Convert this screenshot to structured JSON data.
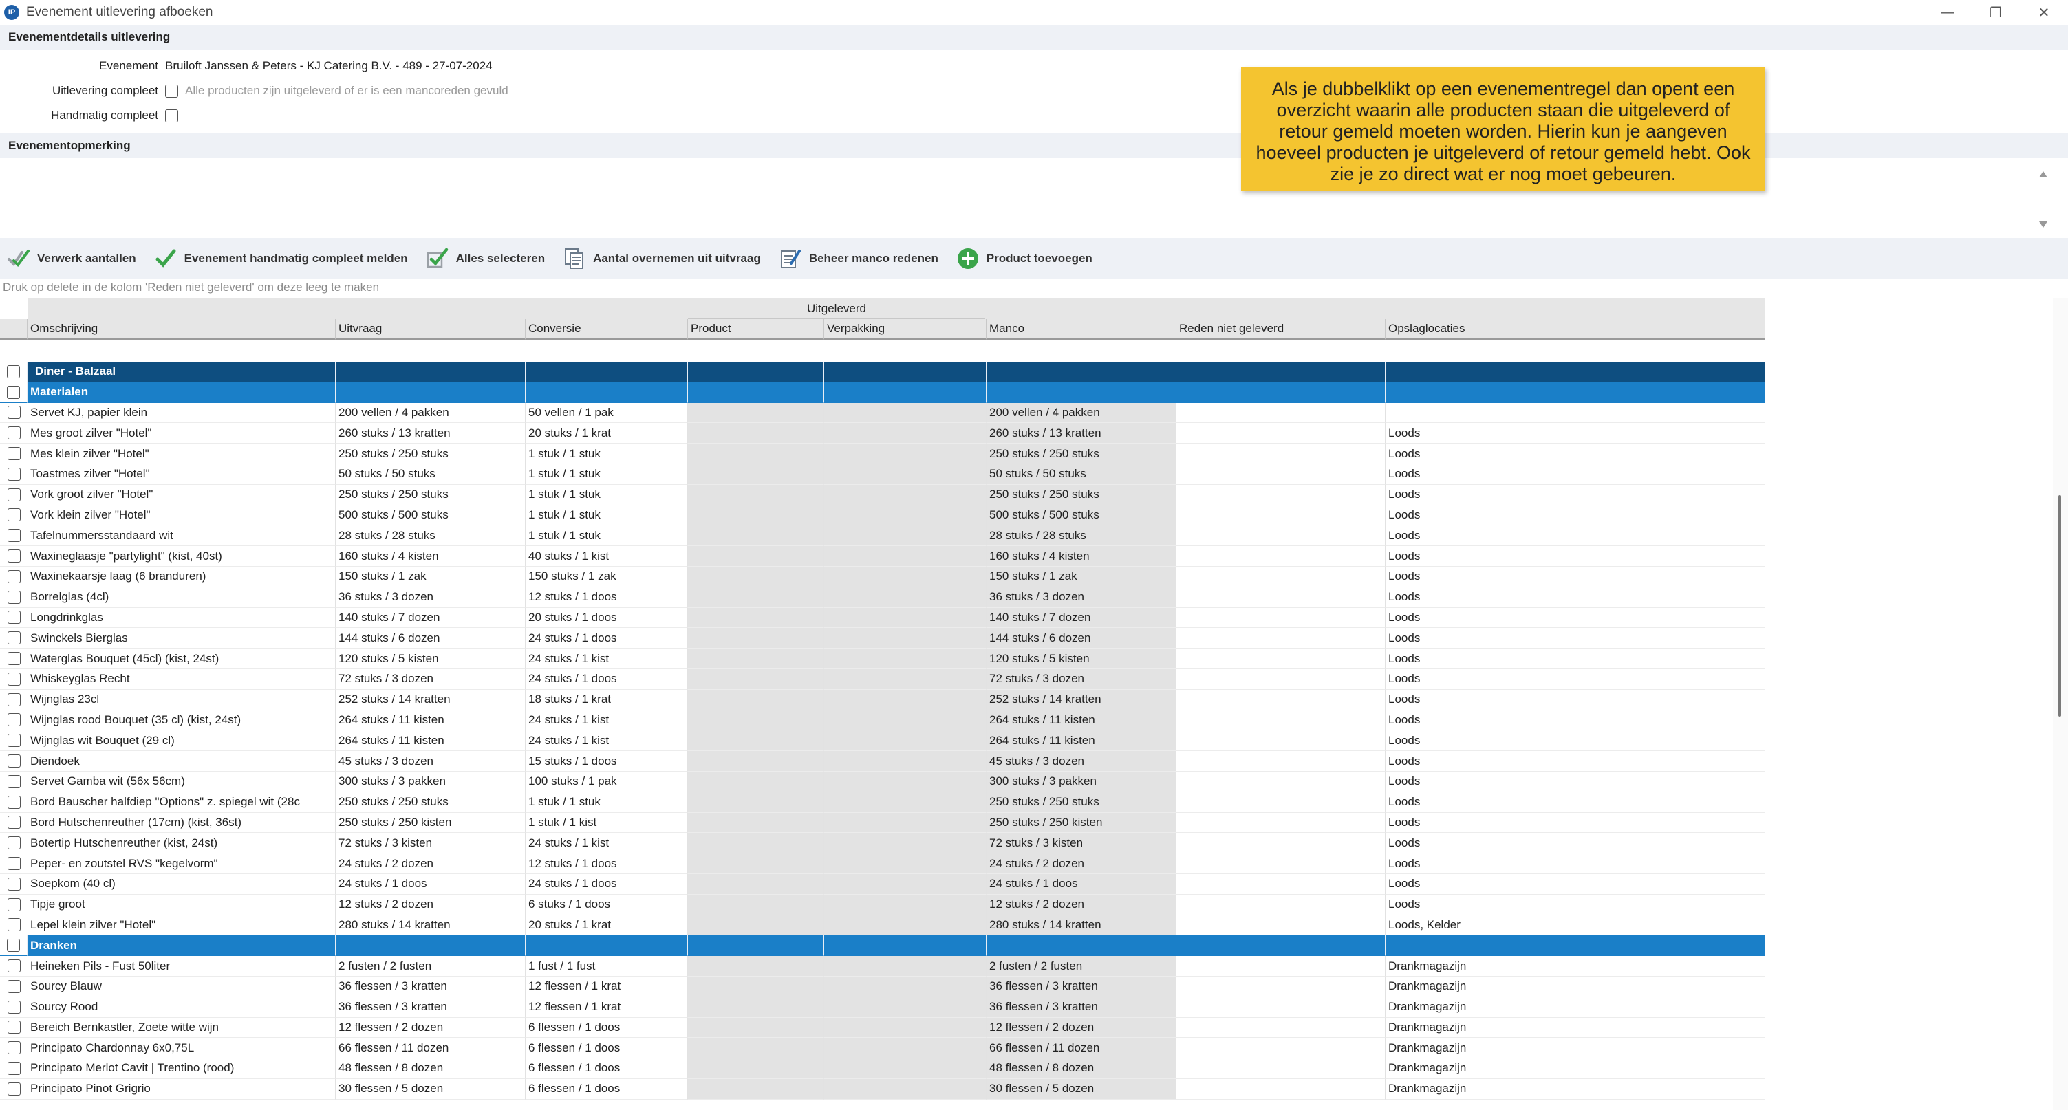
{
  "window": {
    "title": "Evenement uitlevering afboeken",
    "icon_label": "IP",
    "minimize_glyph": "—",
    "restore_glyph": "❐",
    "close_glyph": "✕"
  },
  "details": {
    "section_title": "Evenementdetails uitlevering",
    "event_label": "Evenement",
    "event_value": "Bruiloft Janssen & Peters - KJ Catering B.V. -  489 -  27-07-2024",
    "delivery_complete_label": "Uitlevering compleet",
    "delivery_complete_hint": "Alle producten zijn uitgeleverd of er is een mancoreden gevuld",
    "manual_complete_label": "Handmatig compleet"
  },
  "remark": {
    "section_title": "Evenementopmerking"
  },
  "tooltip": {
    "text": "Als je dubbelklikt op een evenementregel dan opent een overzicht waarin alle producten staan die uitgeleverd of retour gemeld moeten worden. Hierin kun je aangeven hoeveel producten je uitgeleverd of retour gemeld hebt. Ook zie je zo direct wat er nog moet gebeuren."
  },
  "toolbar": {
    "process_label": "Verwerk aantallen",
    "manual_complete_label": "Evenement handmatig compleet melden",
    "select_all_label": "Alles selecteren",
    "copy_qty_label": "Aantal overnemen uit uitvraag",
    "manage_reasons_label": "Beheer manco redenen",
    "add_product_label": "Product toevoegen"
  },
  "hint_line": "Druk op delete in de kolom 'Reden niet geleverd' om deze leeg te maken",
  "colors": {
    "category_bg": "#1a7fc8",
    "category_selected_bg": "#0e4e80",
    "tooltip_bg": "#f4c430",
    "check_green": "#3aa44a"
  },
  "grid": {
    "group_header": "Uitgeleverd",
    "columns": [
      "Omschrijving",
      "Uitvraag",
      "Conversie",
      "Product",
      "Verpakking",
      "Manco",
      "Reden niet geleverd",
      "Opslaglocaties"
    ],
    "rows": [
      {
        "type": "cat",
        "selected": true,
        "desc": "Diner - Balzaal"
      },
      {
        "type": "cat",
        "desc": "Materialen"
      },
      {
        "desc": "Servet KJ, papier klein",
        "uit": "200 vellen / 4 pakken",
        "conv": "50 vellen / 1 pak",
        "manco": "200 vellen / 4 pakken",
        "opsl": ""
      },
      {
        "desc": "Mes groot zilver \"Hotel\"",
        "uit": "260 stuks / 13 kratten",
        "conv": "20 stuks / 1 krat",
        "manco": "260 stuks / 13 kratten",
        "opsl": "Loods"
      },
      {
        "desc": "Mes klein zilver \"Hotel\"",
        "uit": "250 stuks / 250 stuks",
        "conv": "1 stuk / 1 stuk",
        "manco": "250 stuks / 250 stuks",
        "opsl": "Loods"
      },
      {
        "desc": "Toastmes zilver \"Hotel\"",
        "uit": "50 stuks / 50 stuks",
        "conv": "1 stuk / 1 stuk",
        "manco": "50 stuks / 50 stuks",
        "opsl": "Loods"
      },
      {
        "desc": "Vork groot zilver \"Hotel\"",
        "uit": "250 stuks / 250 stuks",
        "conv": "1 stuk / 1 stuk",
        "manco": "250 stuks / 250 stuks",
        "opsl": "Loods"
      },
      {
        "desc": "Vork klein zilver \"Hotel\"",
        "uit": "500 stuks / 500 stuks",
        "conv": "1 stuk / 1 stuk",
        "manco": "500 stuks / 500 stuks",
        "opsl": "Loods"
      },
      {
        "desc": "Tafelnummersstandaard wit",
        "uit": "28 stuks / 28 stuks",
        "conv": "1 stuk / 1 stuk",
        "manco": "28 stuks / 28 stuks",
        "opsl": "Loods"
      },
      {
        "desc": "Waxineglaasje \"partylight\" (kist, 40st)",
        "uit": "160 stuks / 4 kisten",
        "conv": "40 stuks / 1 kist",
        "manco": "160 stuks / 4 kisten",
        "opsl": "Loods"
      },
      {
        "desc": "Waxinekaarsje laag (6 branduren)",
        "uit": "150 stuks / 1 zak",
        "conv": "150 stuks / 1 zak",
        "manco": "150 stuks / 1 zak",
        "opsl": "Loods"
      },
      {
        "desc": "Borrelglas (4cl)",
        "uit": "36 stuks / 3 dozen",
        "conv": "12 stuks / 1 doos",
        "manco": "36 stuks / 3 dozen",
        "opsl": "Loods"
      },
      {
        "desc": "Longdrinkglas",
        "uit": "140 stuks / 7 dozen",
        "conv": "20 stuks / 1 doos",
        "manco": "140 stuks / 7 dozen",
        "opsl": "Loods"
      },
      {
        "desc": "Swinckels Bierglas",
        "uit": "144 stuks / 6 dozen",
        "conv": "24 stuks / 1 doos",
        "manco": "144 stuks / 6 dozen",
        "opsl": "Loods"
      },
      {
        "desc": "Waterglas Bouquet (45cl) (kist, 24st)",
        "uit": "120 stuks / 5 kisten",
        "conv": "24 stuks / 1 kist",
        "manco": "120 stuks / 5 kisten",
        "opsl": "Loods"
      },
      {
        "desc": "Whiskeyglas Recht",
        "uit": "72 stuks / 3 dozen",
        "conv": "24 stuks / 1 doos",
        "manco": "72 stuks / 3 dozen",
        "opsl": "Loods"
      },
      {
        "desc": "Wijnglas 23cl",
        "uit": "252 stuks / 14 kratten",
        "conv": "18 stuks / 1 krat",
        "manco": "252 stuks / 14 kratten",
        "opsl": "Loods"
      },
      {
        "desc": "Wijnglas rood Bouquet (35 cl) (kist, 24st)",
        "uit": "264 stuks / 11 kisten",
        "conv": "24 stuks / 1 kist",
        "manco": "264 stuks / 11 kisten",
        "opsl": "Loods"
      },
      {
        "desc": "Wijnglas wit Bouquet (29 cl)",
        "uit": "264 stuks / 11 kisten",
        "conv": "24 stuks / 1 kist",
        "manco": "264 stuks / 11 kisten",
        "opsl": "Loods"
      },
      {
        "desc": "Diendoek",
        "uit": "45 stuks / 3 dozen",
        "conv": "15 stuks / 1 doos",
        "manco": "45 stuks / 3 dozen",
        "opsl": "Loods"
      },
      {
        "desc": "Servet Gamba wit (56x 56cm)",
        "uit": "300 stuks / 3 pakken",
        "conv": "100 stuks / 1 pak",
        "manco": "300 stuks / 3 pakken",
        "opsl": "Loods"
      },
      {
        "desc": "Bord Bauscher halfdiep \"Options\" z. spiegel wit (28c",
        "uit": "250 stuks / 250 stuks",
        "conv": "1 stuk / 1 stuk",
        "manco": "250 stuks / 250 stuks",
        "opsl": "Loods"
      },
      {
        "desc": "Bord Hutschenreuther (17cm) (kist, 36st)",
        "uit": "250 stuks / 250 kisten",
        "conv": "1 stuk / 1 kist",
        "manco": "250 stuks / 250 kisten",
        "opsl": "Loods"
      },
      {
        "desc": "Botertip Hutschenreuther (kist, 24st)",
        "uit": "72 stuks / 3 kisten",
        "conv": "24 stuks / 1 kist",
        "manco": "72 stuks / 3 kisten",
        "opsl": "Loods"
      },
      {
        "desc": "Peper- en zoutstel RVS \"kegelvorm\"",
        "uit": "24 stuks / 2 dozen",
        "conv": "12 stuks / 1 doos",
        "manco": "24 stuks / 2 dozen",
        "opsl": "Loods"
      },
      {
        "desc": "Soepkom (40 cl)",
        "uit": "24 stuks / 1 doos",
        "conv": "24 stuks / 1 doos",
        "manco": "24 stuks / 1 doos",
        "opsl": "Loods"
      },
      {
        "desc": "Tipje groot",
        "uit": "12 stuks / 2 dozen",
        "conv": "6 stuks / 1 doos",
        "manco": "12 stuks / 2 dozen",
        "opsl": "Loods"
      },
      {
        "desc": "Lepel klein zilver \"Hotel\"",
        "uit": "280 stuks / 14 kratten",
        "conv": "20 stuks / 1 krat",
        "manco": "280 stuks / 14 kratten",
        "opsl": "Loods, Kelder"
      },
      {
        "type": "cat",
        "desc": "Dranken"
      },
      {
        "desc": "Heineken Pils - Fust 50liter",
        "uit": "2 fusten / 2 fusten",
        "conv": "1 fust / 1 fust",
        "manco": "2 fusten / 2 fusten",
        "opsl": "Drankmagazijn"
      },
      {
        "desc": "Sourcy Blauw",
        "uit": "36 flessen / 3 kratten",
        "conv": "12 flessen / 1 krat",
        "manco": "36 flessen / 3 kratten",
        "opsl": "Drankmagazijn"
      },
      {
        "desc": "Sourcy Rood",
        "uit": "36 flessen / 3 kratten",
        "conv": "12 flessen / 1 krat",
        "manco": "36 flessen / 3 kratten",
        "opsl": "Drankmagazijn"
      },
      {
        "desc": "Bereich Bernkastler, Zoete witte wijn",
        "uit": "12 flessen / 2 dozen",
        "conv": "6 flessen / 1 doos",
        "manco": "12 flessen / 2 dozen",
        "opsl": "Drankmagazijn"
      },
      {
        "desc": "Principato Chardonnay 6x0,75L",
        "uit": "66 flessen / 11 dozen",
        "conv": "6 flessen / 1 doos",
        "manco": "66 flessen / 11 dozen",
        "opsl": "Drankmagazijn"
      },
      {
        "desc": "Principato Merlot Cavit | Trentino (rood)",
        "uit": "48 flessen / 8 dozen",
        "conv": "6 flessen / 1 doos",
        "manco": "48 flessen / 8 dozen",
        "opsl": "Drankmagazijn"
      },
      {
        "desc": "Principato Pinot Grigrio",
        "uit": "30 flessen / 5 dozen",
        "conv": "6 flessen / 1 doos",
        "manco": "30 flessen / 5 dozen",
        "opsl": "Drankmagazijn"
      }
    ]
  }
}
